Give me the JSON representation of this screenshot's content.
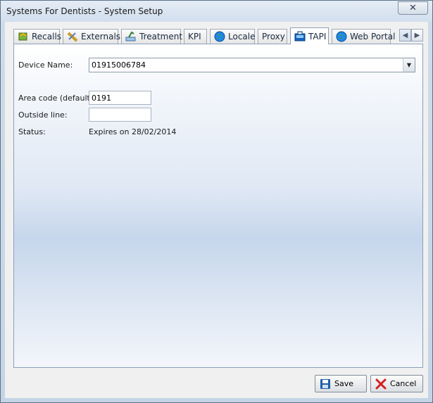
{
  "window": {
    "title": "Systems For Dentists - System Setup",
    "close_glyph": "✕"
  },
  "tabs": [
    {
      "label": "Recalls",
      "icon": "recalls-icon"
    },
    {
      "label": "Externals",
      "icon": "externals-icon"
    },
    {
      "label": "Treatment",
      "icon": "treatment-icon"
    },
    {
      "label": "KPI",
      "icon": ""
    },
    {
      "label": "Locale",
      "icon": "globe-icon"
    },
    {
      "label": "Proxy",
      "icon": ""
    },
    {
      "label": "TAPI",
      "icon": "phone-icon",
      "active": true
    },
    {
      "label": "Web Portal",
      "icon": "globe-icon"
    }
  ],
  "tab_scroll": {
    "left": "◀",
    "right": "▶"
  },
  "form": {
    "device_name_label": "Device Name:",
    "device_name_value": "01915006784",
    "area_code_label": "Area code (default):",
    "area_code_value": "0191",
    "outside_line_label": "Outside line:",
    "outside_line_value": "",
    "status_label": "Status:",
    "status_value": "Expires on 28/02/2014"
  },
  "buttons": {
    "save_label": "Save",
    "cancel_label": "Cancel"
  },
  "colors": {
    "accent": "#3399ff",
    "cancel_icon": "#d42020",
    "save_icon": "#1f5fa8"
  }
}
